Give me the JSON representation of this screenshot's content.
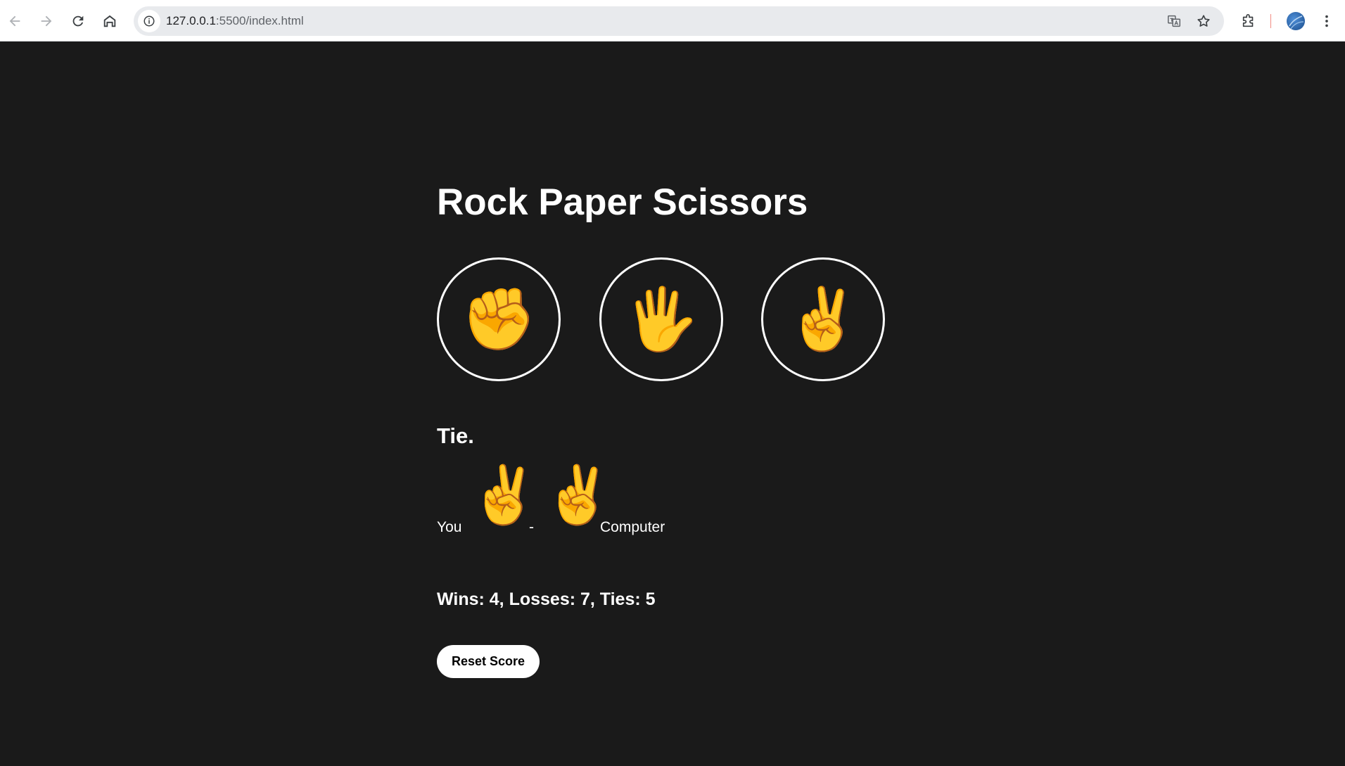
{
  "browser": {
    "url_host": "127.0.0.1",
    "url_path": ":5500/index.html",
    "icons": [
      "back-icon",
      "forward-icon",
      "reload-icon",
      "home-icon",
      "info-icon",
      "translate-icon",
      "star-icon",
      "extensions-icon",
      "avatar",
      "more-icon"
    ]
  },
  "page": {
    "title": "Rock Paper Scissors",
    "moves": [
      {
        "name": "rock",
        "emoji": "✊"
      },
      {
        "name": "paper",
        "emoji": "🖐"
      },
      {
        "name": "scissors",
        "emoji": "✌"
      }
    ],
    "result": "Tie.",
    "moves_display": {
      "you_label": "You",
      "player_emoji": "✌",
      "separator": "-",
      "computer_emoji": "✌",
      "computer_label": "Computer"
    },
    "score_text": "Wins: 4, Losses: 7, Ties: 5",
    "reset_label": "Reset Score"
  },
  "colors": {
    "background": "#1a1a1a",
    "text": "#ffffff",
    "emoji": "#f6b93b"
  }
}
